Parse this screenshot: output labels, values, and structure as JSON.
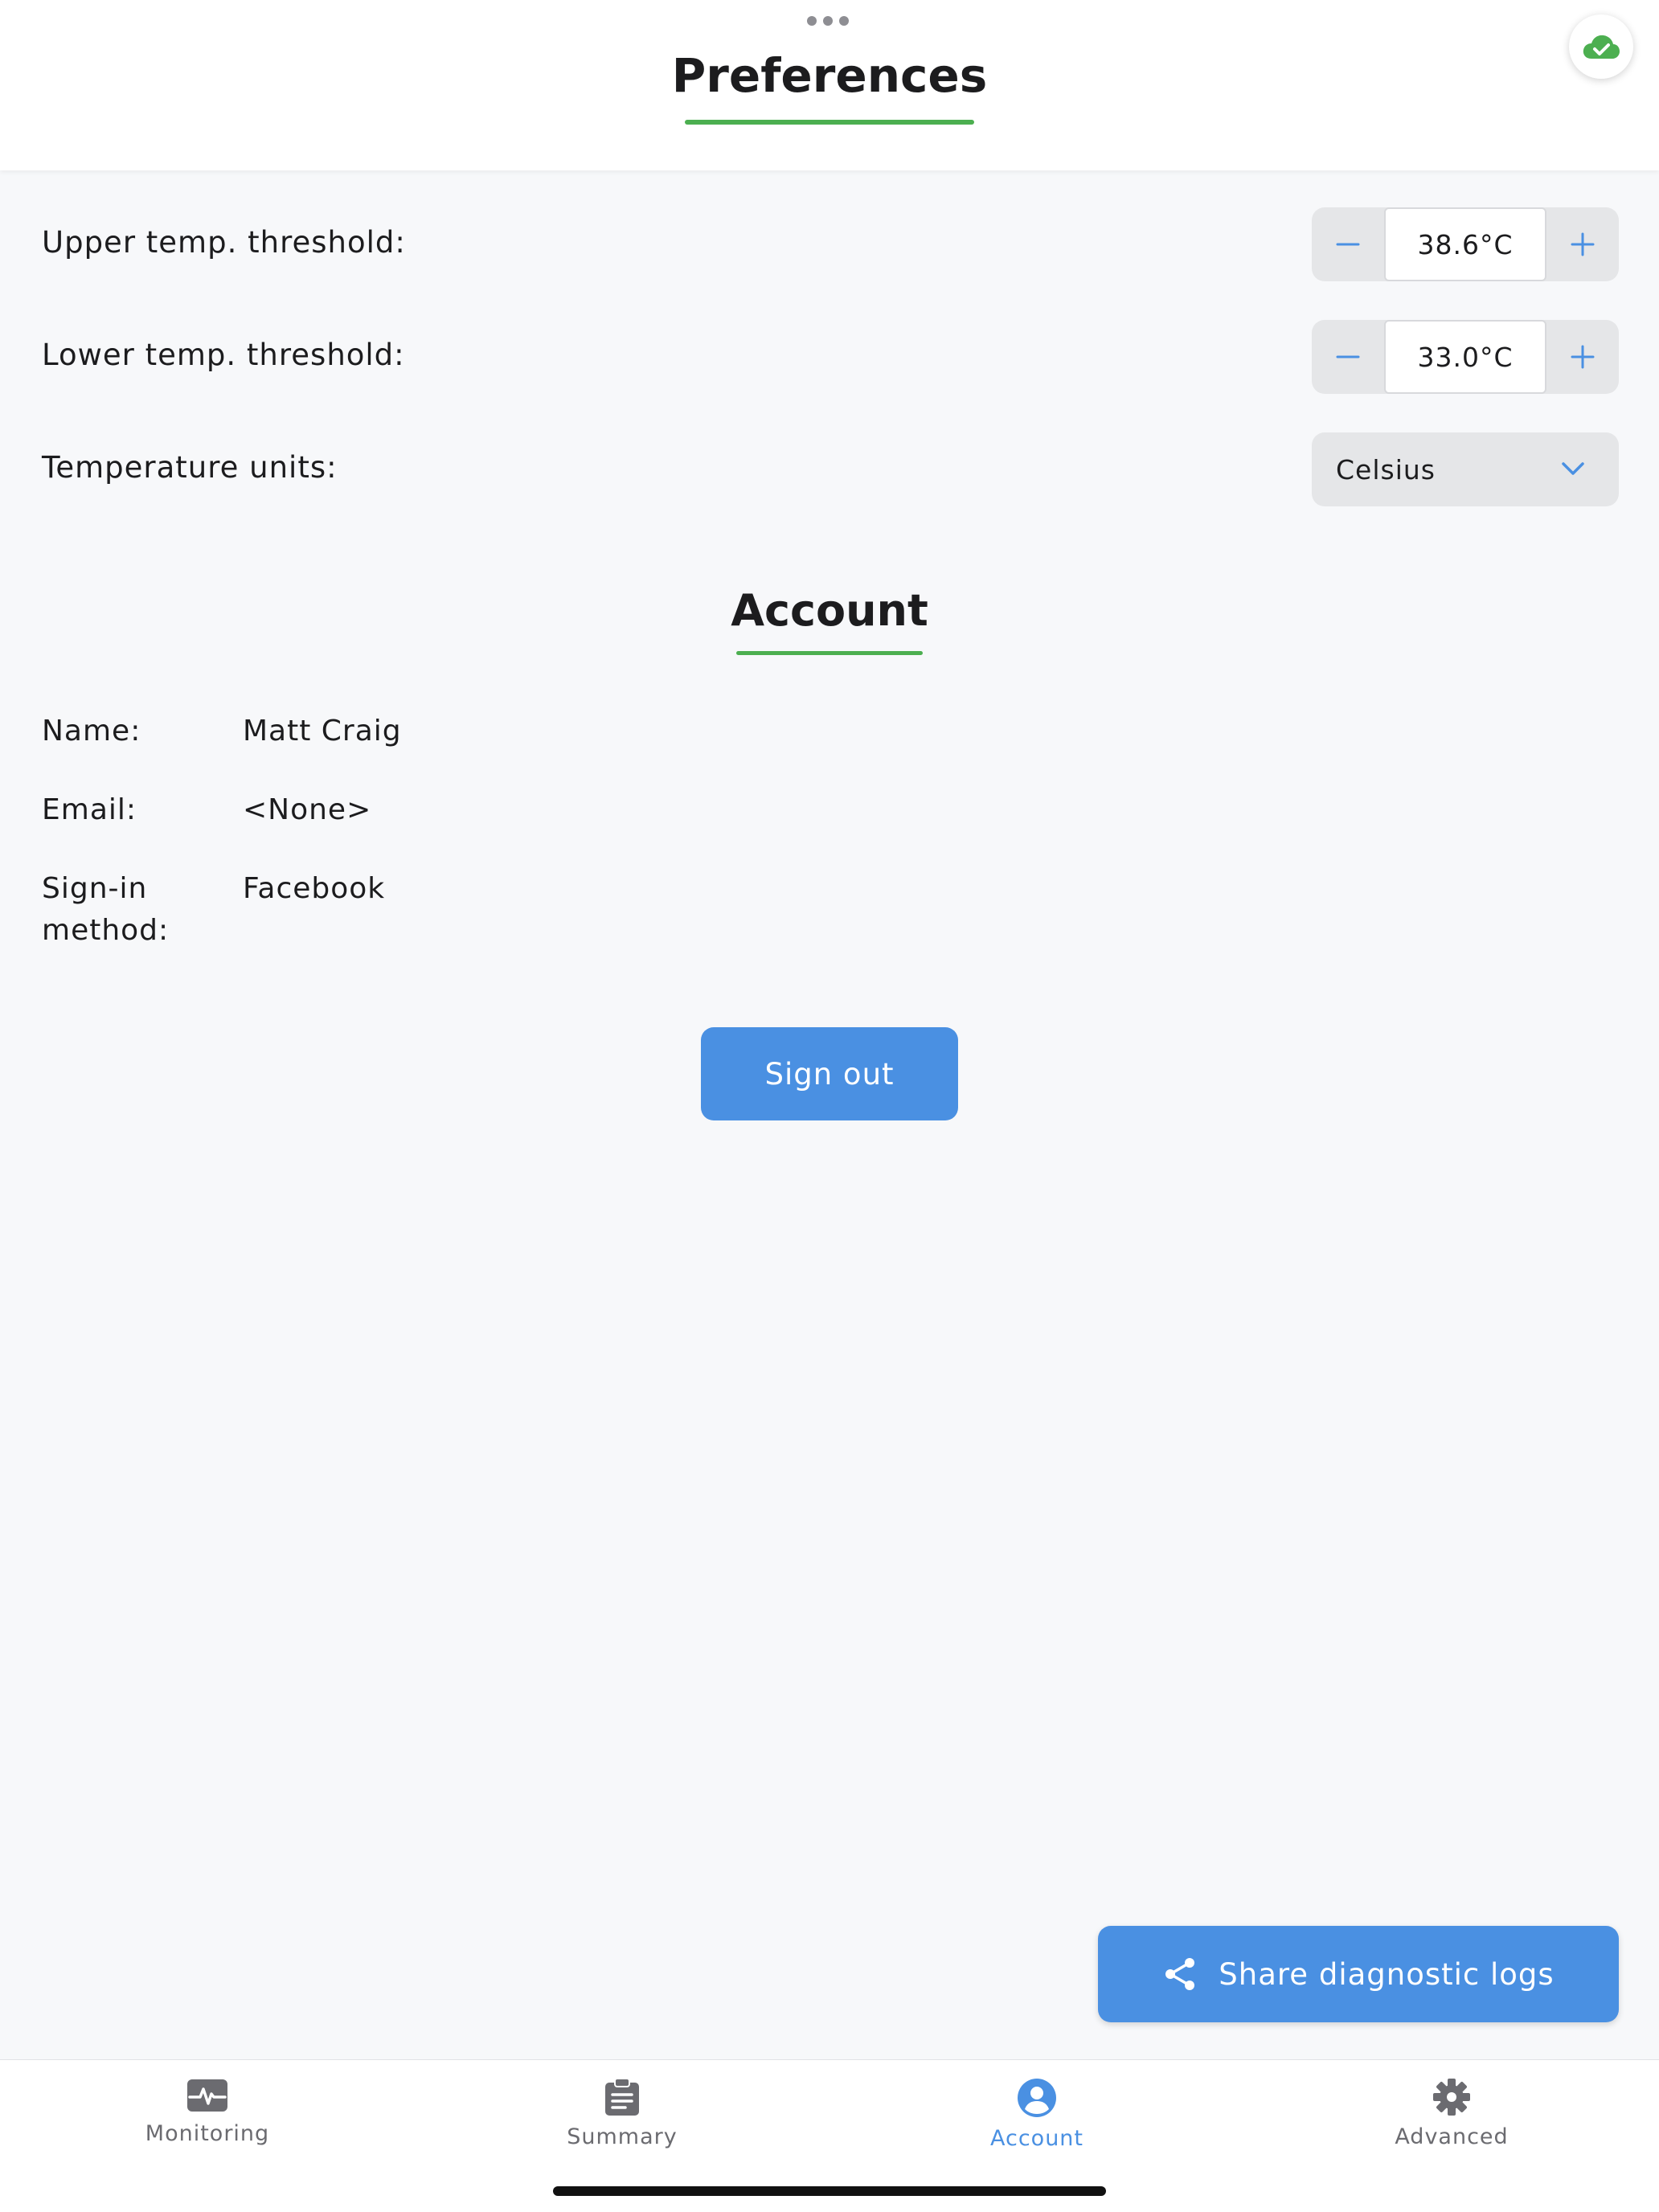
{
  "header": {
    "title": "Preferences"
  },
  "preferences": {
    "upper": {
      "label": "Upper temp. threshold:",
      "value": "38.6°C"
    },
    "lower": {
      "label": "Lower temp. threshold:",
      "value": "33.0°C"
    },
    "units": {
      "label": "Temperature units:",
      "selected": "Celsius"
    }
  },
  "account": {
    "title": "Account",
    "name": {
      "label": "Name:",
      "value": "Matt Craig"
    },
    "email": {
      "label": "Email:",
      "value": "<None>"
    },
    "signin": {
      "label_line1": "Sign-in",
      "label_line2": "method:",
      "value": "Facebook"
    },
    "signout_label": "Sign out"
  },
  "share_logs_label": "Share diagnostic logs",
  "tabs": [
    {
      "label": "Monitoring",
      "icon": "monitor-heartbeat-icon"
    },
    {
      "label": "Summary",
      "icon": "clipboard-icon"
    },
    {
      "label": "Account",
      "icon": "account-icon",
      "active": true
    },
    {
      "label": "Advanced",
      "icon": "gear-icon"
    }
  ],
  "colors": {
    "accent": "#4a90e2",
    "green": "#4caf50",
    "inactive": "#6b6b70"
  }
}
